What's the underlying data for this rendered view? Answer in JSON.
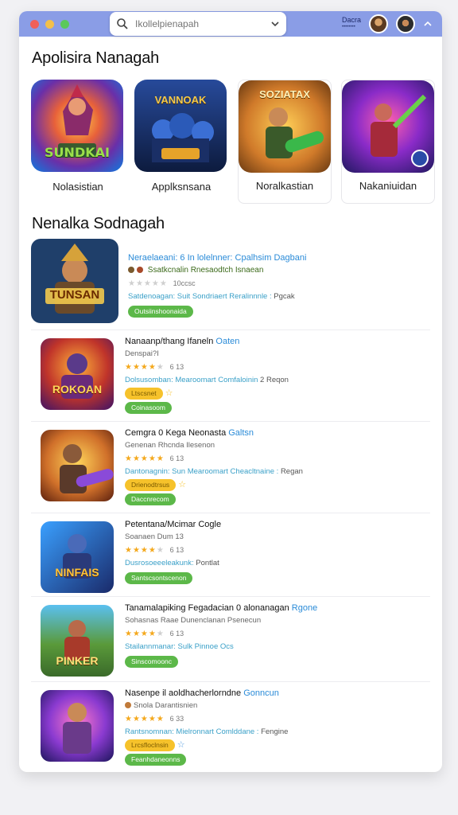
{
  "titlebar": {
    "search_placeholder": "Ikollelpienapah",
    "user_name": "Dacra",
    "user_sub": "••••••••"
  },
  "featured": {
    "title": "Apolisira Nanagah",
    "cards": [
      {
        "label": "Nolasistian",
        "art": "SUNDKAI"
      },
      {
        "label": "Applksnsana",
        "art": "VANNOAK"
      },
      {
        "label": "Noralkastian",
        "art": "SOZIATAX"
      },
      {
        "label": "Nakaniuidan",
        "art": ""
      }
    ]
  },
  "list": {
    "title": "Nenalka Sodnagah",
    "items": [
      {
        "name": "Neraelaeani: 6 In lolelnner:",
        "name_tag": "Cpalhsim Dagbani",
        "sub": "Ssatkcnalin Rnesaodtch Isnaean",
        "rating_text": "10ccsc",
        "meta": "Satdenoagan: Suit Sondriaert Reralinnnle :",
        "meta_dark": "Pgcak",
        "pill": "Outsiinshoonaida",
        "art": "TUNSAN"
      },
      {
        "name": "Nanaanp/thang Ifaneln",
        "name_tag": "Oaten",
        "sub": "Denspai?I",
        "rating_text": "6 13",
        "meta": "Dolsusomban: Mearoomart Comfaloinin",
        "meta_dark": "2 Reqon",
        "pill_yellow": "Ltscsnet",
        "pill": "Coinasoom",
        "art": "ROKOAN"
      },
      {
        "name": "Cemgra 0 Kega Neonasta",
        "name_tag": "Galtsn",
        "sub": "Genenan Rhcnda Ilesenon",
        "rating_text": "6 13",
        "meta": "Dantonagnin: Sun Mearoomart Cheacltnaine :",
        "meta_dark": "Regan",
        "pill_yellow": "Drienodtrsus",
        "pill": "Daccnrecom",
        "art": ""
      },
      {
        "name": "Petentana/Mcimar Cogle",
        "name_tag": "",
        "sub": "Soanaen Dum 13",
        "rating_text": "6 13",
        "meta": "Dusrosoeeeleakunk:",
        "meta_dark": "Pontlat",
        "pill": "Santscsontscenon",
        "art": "NINFAIS"
      },
      {
        "name": "Tanamalapiking Fegadacian 0 alonanagan",
        "name_tag": "Rgone",
        "sub": "Sohasnas Raae Dunenclanan Psenecun",
        "rating_text": "6 13",
        "meta": "Stailannmanar: Sulk Pinnoe Ocs",
        "meta_dark": "",
        "pill": "Sinscomoonc",
        "art": "PINKER"
      },
      {
        "name": "Nasenpe il aoldhacherlorndne",
        "name_tag": "Gonncun",
        "sub": "Snola Darantisnien",
        "rating_text": "6 33",
        "meta": "Rantsnomnan: Mielronnart Comlddane :",
        "meta_dark": "Fengine",
        "pill_yellow": "Lrcsfloclnsin",
        "pill": "Feanhdaneonns",
        "art": ""
      }
    ]
  },
  "colors": {
    "titlebar": "#8a9de6",
    "accent_blue": "#2a8bd8",
    "star": "#f4a81c",
    "pill_green": "#5cb849",
    "pill_yellow": "#f6c22b"
  }
}
